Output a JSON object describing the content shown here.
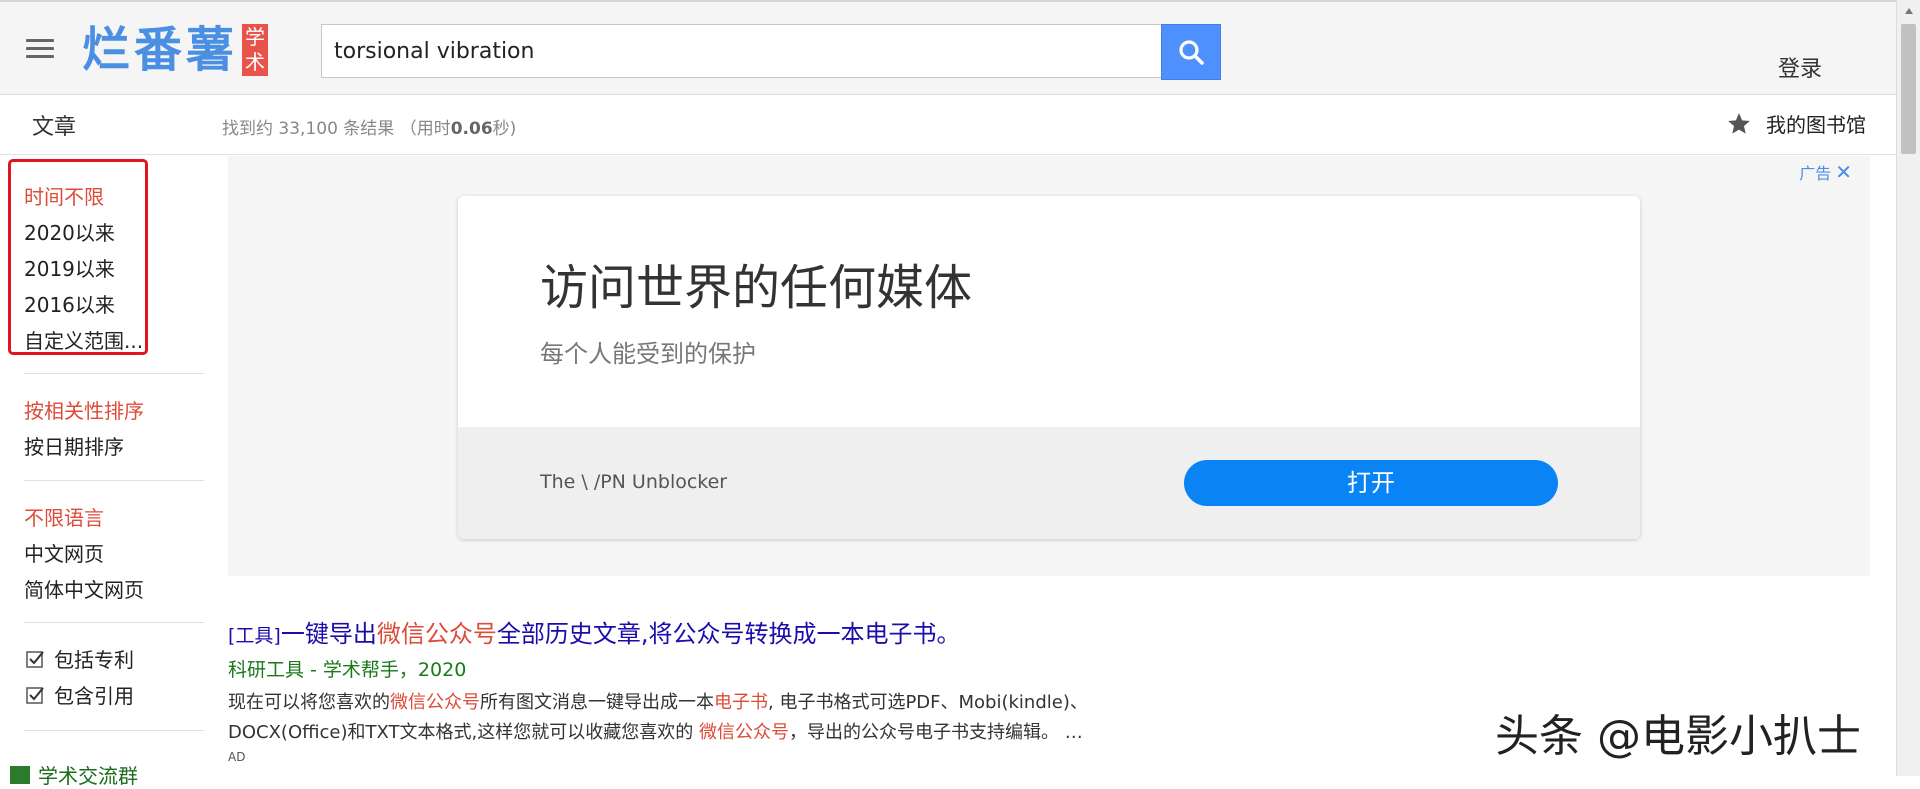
{
  "header": {
    "logo_text": "烂番薯",
    "logo_badge": "学术",
    "search_value": "torsional vibration",
    "login_label": "登录"
  },
  "subbar": {
    "section": "文章",
    "stats_prefix": "找到约 33,100 条结果 （用时",
    "stats_time": "0.06",
    "stats_suffix": "秒)",
    "library_label": "我的图书馆"
  },
  "sidebar": {
    "time_filters": [
      "时间不限",
      "2020以来",
      "2019以来",
      "2016以来",
      "自定义范围..."
    ],
    "sort_options": [
      "按相关性排序",
      "按日期排序"
    ],
    "language_options": [
      "不限语言",
      "中文网页",
      "简体中文网页"
    ],
    "checkboxes": [
      "包括专利",
      "包含引用"
    ],
    "group_link": "学术交流群"
  },
  "ad": {
    "label": "广告",
    "headline": "访问世界的任何媒体",
    "subline": "每个人能受到的保护",
    "brand": "The \\ /PN Unblocker",
    "button": "打开"
  },
  "result": {
    "tag": "[工具]",
    "title_part1": "一键导出",
    "title_highlight": "微信公众号",
    "title_part2": "全部历史文章,将公众号转换成一本电子书。",
    "meta": "科研工具 - 学术帮手，2020",
    "snippet_1a": "现在可以将您喜欢的",
    "snippet_1hl": "微信公众号",
    "snippet_1b": "所有图文消息一键导出成一本",
    "snippet_1hl2": "电子书",
    "snippet_1c": ", 电子书格式可选PDF、Mobi(kindle)、",
    "snippet_2a": "DOCX(Office)和TXT文本格式,这样您就可以收藏您喜欢的 ",
    "snippet_2hl": "微信公众号",
    "snippet_2b": "，导出的公众号电子书支持编辑。 …",
    "ad_tag": "AD"
  },
  "watermark": "头条 @电影小扒士",
  "colors": {
    "accent_blue": "#4d90fe",
    "active_red": "#dd4b39",
    "highlight_box": "#e0161c",
    "ad_button": "#0a84f5"
  }
}
